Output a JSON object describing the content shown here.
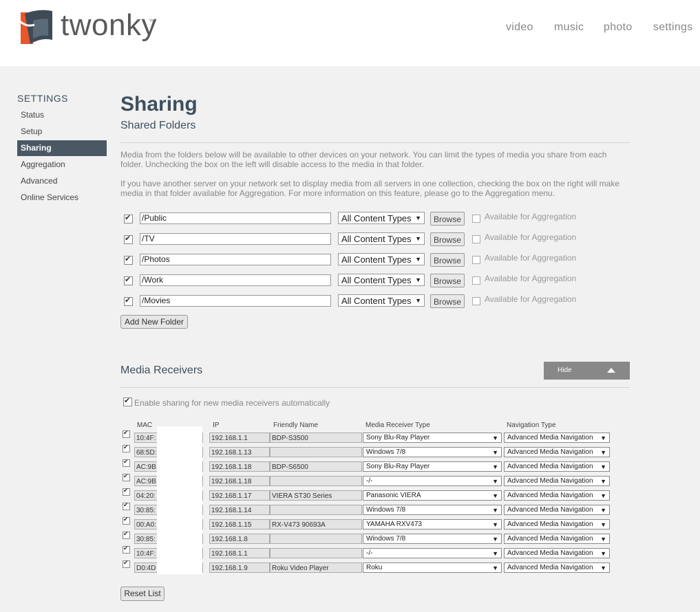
{
  "brand": {
    "name": "twonky",
    "tm": "™"
  },
  "nav": [
    "video",
    "music",
    "photo",
    "settings"
  ],
  "sidebar": {
    "title": "SETTINGS",
    "items": [
      "Status",
      "Setup",
      "Sharing",
      "Aggregation",
      "Advanced",
      "Online Services"
    ],
    "active": "Sharing"
  },
  "page": {
    "title": "Sharing",
    "subtitle": "Shared Folders",
    "para1": "Media from the folders below will be available to other devices on your network. You can limit the types of media you share from each folder. Unchecking the box on the left will disable access to the media in that folder.",
    "para2": "If you have another server on your network set to display media from all servers in one collection, checking the box on the right will make media in that folder available for Aggregation. For more information on this feature, please go to the Aggregation menu."
  },
  "folders": [
    {
      "path": "/Public",
      "type": "All Content Types",
      "checked": true,
      "aggregation": false
    },
    {
      "path": "/TV",
      "type": "All Content Types",
      "checked": true,
      "aggregation": false
    },
    {
      "path": "/Photos",
      "type": "All Content Types",
      "checked": true,
      "aggregation": false
    },
    {
      "path": "/Work",
      "type": "All Content Types",
      "checked": true,
      "aggregation": false
    },
    {
      "path": "/Movies",
      "type": "All Content Types",
      "checked": true,
      "aggregation": false
    }
  ],
  "labels": {
    "browse": "Browse",
    "aggregation": "Available for Aggregation",
    "add_folder": "Add New Folder",
    "media_receivers": "Media Receivers",
    "hide": "Hide",
    "enable_sharing": "Enable sharing for new media receivers automatically",
    "reset_list": "Reset List"
  },
  "receivers_table": {
    "headers": [
      "MAC",
      "IP",
      "Friendly Name",
      "Media Receiver Type",
      "Navigation Type"
    ],
    "rows": [
      {
        "mac": "10:4F:",
        "ip": "192.168.1.1",
        "name": "BDP-S3500",
        "type": "Sony Blu-Ray Player",
        "nav": "Advanced Media Navigation"
      },
      {
        "mac": "68:5D:",
        "ip": "192.168.1.13",
        "name": "",
        "type": "Windows 7/8",
        "nav": "Advanced Media Navigation"
      },
      {
        "mac": "AC:9B",
        "ip": "192.168.1.18",
        "name": "BDP-S6500",
        "type": "Sony Blu-Ray Player",
        "nav": "Advanced Media Navigation"
      },
      {
        "mac": "AC:9B",
        "ip": "192.168.1.18",
        "name": "",
        "type": "-/-",
        "nav": "Advanced Media Navigation"
      },
      {
        "mac": "04:20:",
        "ip": "192.168.1.17",
        "name": "VIERA ST30 Series",
        "type": "Panasonic VIERA",
        "nav": "Advanced Media Navigation"
      },
      {
        "mac": "30:85:",
        "ip": "192.168.1.14",
        "name": "",
        "type": "Windows 7/8",
        "nav": "Advanced Media Navigation"
      },
      {
        "mac": "00:A0:",
        "ip": "192.168.1.15",
        "name": "RX-V473 90693A",
        "type": "YAMAHA RXV473",
        "nav": "Advanced Media Navigation"
      },
      {
        "mac": "30:85:",
        "ip": "192.168.1.8",
        "name": "",
        "type": "Windows 7/8",
        "nav": "Advanced Media Navigation"
      },
      {
        "mac": "10:4F:",
        "ip": "192.168.1.1",
        "name": "",
        "type": "-/-",
        "nav": "Advanced Media Navigation"
      },
      {
        "mac": "D0:4D",
        "ip": "192.168.1.9",
        "name": "Roku Video Player",
        "type": "Roku",
        "nav": "Advanced Media Navigation"
      }
    ]
  },
  "colors": {
    "accent": "#4a5866",
    "heading": "#3f4f5d",
    "logo_orange": "#e8572a",
    "logo_dark": "#3e4b57"
  }
}
